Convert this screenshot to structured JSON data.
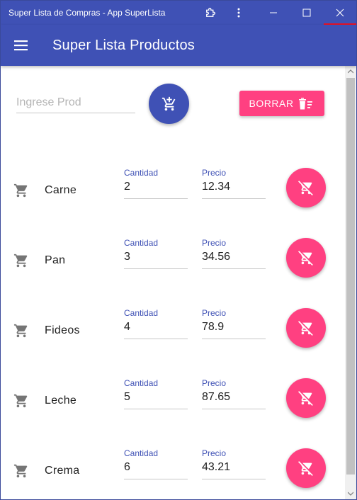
{
  "window": {
    "title": "Super Lista de Compras - App SuperLista",
    "controls": [
      "extensions-icon",
      "more-vert-icon",
      "minimize-icon",
      "maximize-icon",
      "close-icon"
    ]
  },
  "appbar": {
    "title": "Super Lista Productos",
    "menu_icon": "menu-icon"
  },
  "input": {
    "placeholder": "Ingrese Prod",
    "value": ""
  },
  "add_button": {
    "icon": "add-shopping-cart-icon"
  },
  "clear_button": {
    "label": "BORRAR",
    "icon": "delete-sweep-icon"
  },
  "labels": {
    "quantity": "Cantidad",
    "price": "Precio"
  },
  "items": [
    {
      "name": "Carne",
      "quantity": "2",
      "price": "12.34"
    },
    {
      "name": "Pan",
      "quantity": "3",
      "price": "34.56"
    },
    {
      "name": "Fideos",
      "quantity": "4",
      "price": "78.9"
    },
    {
      "name": "Leche",
      "quantity": "5",
      "price": "87.65"
    },
    {
      "name": "Crema",
      "quantity": "6",
      "price": "43.21"
    }
  ],
  "colors": {
    "primary": "#3f51b5",
    "accent": "#ff4081",
    "label": "#3f51b5"
  }
}
